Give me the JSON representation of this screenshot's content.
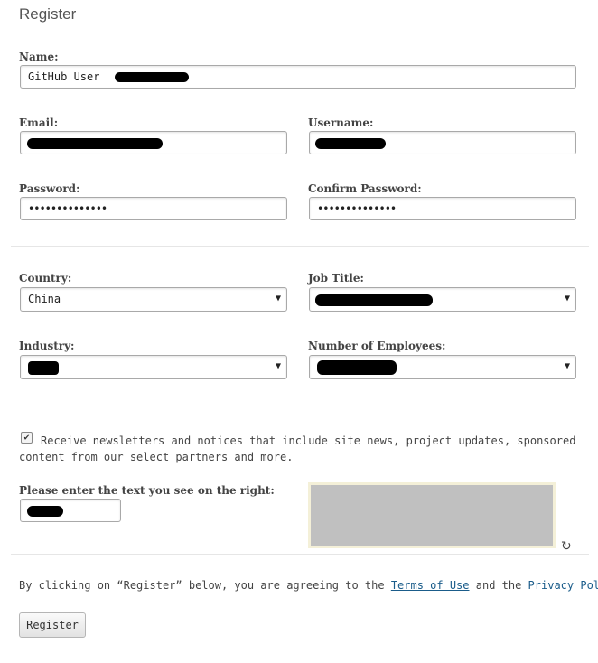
{
  "page": {
    "title": "Register"
  },
  "labels": {
    "name": "Name:",
    "email": "Email:",
    "username": "Username:",
    "password": "Password:",
    "confirm_password": "Confirm Password:",
    "country": "Country:",
    "job_title": "Job Title:",
    "industry": "Industry:",
    "employees": "Number of Employees:",
    "captcha": "Please enter the text you see on the right:"
  },
  "values": {
    "name": "GitHub User",
    "password": "••••••••••••••",
    "confirm_password": "••••••••••••••",
    "country": "China"
  },
  "newsletter": {
    "checked": true,
    "check_mark": "✔",
    "text": "Receive newsletters and notices that include site news, project updates, sponsored content from our select partners and more."
  },
  "agreement": {
    "prefix": "By clicking on “Register” below, you are agreeing to the ",
    "terms_link": "Terms of Use",
    "middle": " and the ",
    "privacy_link": "Privacy Policy",
    "suffix": "."
  },
  "buttons": {
    "register": "Register"
  },
  "icons": {
    "select_arrow": "▼",
    "refresh": "↻"
  }
}
